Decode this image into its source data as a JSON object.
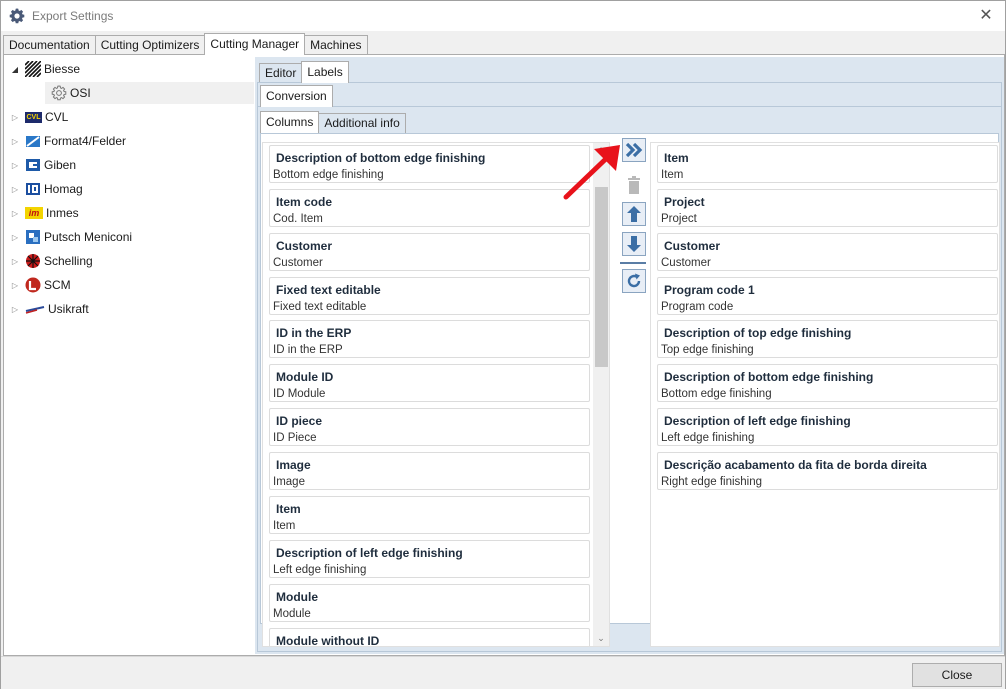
{
  "window": {
    "title": "Export Settings",
    "close_label": "✕"
  },
  "main_tabs": [
    {
      "label": "Documentation"
    },
    {
      "label": "Cutting Optimizers"
    },
    {
      "label": "Cutting Manager"
    },
    {
      "label": "Machines"
    }
  ],
  "tree": {
    "items": [
      {
        "label": "Biesse"
      },
      {
        "label": "OSI"
      },
      {
        "label": "CVL"
      },
      {
        "label": "Format4/Felder"
      },
      {
        "label": "Giben"
      },
      {
        "label": "Homag"
      },
      {
        "label": "Inmes"
      },
      {
        "label": "Putsch Meniconi"
      },
      {
        "label": "Schelling"
      },
      {
        "label": "SCM"
      },
      {
        "label": "Usikraft"
      }
    ],
    "cvl_badge": "CVL",
    "inmes_badge": "im"
  },
  "editor_tabs": [
    {
      "label": "Editor"
    },
    {
      "label": "Labels"
    }
  ],
  "conversion_tab": {
    "label": "Conversion"
  },
  "columns_tabs": [
    {
      "label": "Columns"
    },
    {
      "label": "Additional info"
    }
  ],
  "available_columns": [
    {
      "title": "Description of bottom edge finishing",
      "subtitle": "Bottom edge finishing"
    },
    {
      "title": "Item code",
      "subtitle": "Cod. Item"
    },
    {
      "title": "Customer",
      "subtitle": "Customer"
    },
    {
      "title": "Fixed text editable",
      "subtitle": "Fixed text editable"
    },
    {
      "title": "ID in the ERP",
      "subtitle": "ID in the ERP"
    },
    {
      "title": "Module ID",
      "subtitle": "ID Module"
    },
    {
      "title": "ID piece",
      "subtitle": "ID Piece"
    },
    {
      "title": "Image",
      "subtitle": "Image"
    },
    {
      "title": "Item",
      "subtitle": "Item"
    },
    {
      "title": "Description of left edge finishing",
      "subtitle": "Left edge finishing"
    },
    {
      "title": "Module",
      "subtitle": "Module"
    },
    {
      "title": "Module without ID",
      "subtitle": ""
    }
  ],
  "selected_columns": [
    {
      "title": "Item",
      "subtitle": "Item"
    },
    {
      "title": "Project",
      "subtitle": "Project"
    },
    {
      "title": "Customer",
      "subtitle": "Customer"
    },
    {
      "title": "Program code 1",
      "subtitle": "Program code"
    },
    {
      "title": "Description of top edge finishing",
      "subtitle": "Top edge finishing"
    },
    {
      "title": "Description of bottom edge finishing",
      "subtitle": "Bottom edge finishing"
    },
    {
      "title": "Description of left edge finishing",
      "subtitle": "Left edge finishing"
    },
    {
      "title": "Descrição acabamento da fita de borda direita",
      "subtitle": "Right edge finishing"
    }
  ],
  "footer": {
    "close_label": "Close"
  },
  "colors": {
    "accent": "#3b6ea5",
    "annotation_arrow": "#e8121b",
    "panel_bg": "#dce6f0"
  }
}
